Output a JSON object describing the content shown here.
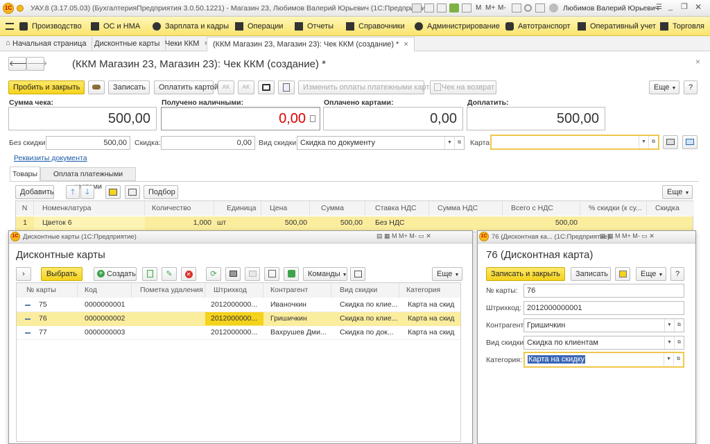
{
  "window": {
    "title": "УАУ.8 (3.17.05.03) (БухгалтерияПредприятия 3.0.50.1221) - Магазин 23, Любимов Валерий Юрьевич (1С:Предприятие)",
    "user": "Любимов Валерий Юрьевич"
  },
  "menu": [
    "Производство",
    "ОС и НМА",
    "Зарплата и кадры",
    "Операции",
    "Отчеты",
    "Справочники",
    "Администрирование",
    "Автотранспорт",
    "Оперативный учет",
    "Торговля"
  ],
  "tabs": [
    "Начальная страница",
    "Дисконтные карты",
    "Чеки ККМ",
    "(ККМ Магазин 23, Магазин 23): Чек ККМ (создание) *"
  ],
  "doc": {
    "title": "(ККМ Магазин 23, Магазин 23): Чек ККМ (создание) *",
    "btn_post_close": "Пробить и закрыть",
    "btn_save": "Записать",
    "btn_pay_card": "Оплатить картой",
    "btn_change_payments": "Изменить оплаты платежными картами",
    "btn_return": "Чек на возврат",
    "btn_more": "Еще",
    "btn_help": "?",
    "sum_label": "Сумма чека:",
    "sum_value": "500,00",
    "cash_label": "Получено наличными:",
    "cash_value": "0,00",
    "card_paid_label": "Оплачено картами:",
    "card_paid_value": "0,00",
    "topay_label": "Доплатить:",
    "topay_value": "500,00",
    "nodisc_label": "Без скидки:",
    "nodisc_value": "500,00",
    "disc_label": "Скидка:",
    "disc_value": "0,00",
    "disctype_label": "Вид скидки:",
    "disctype_value": "Скидка по документу",
    "card_label": "Карта:",
    "card_value": "",
    "requisites_link": "Реквизиты документа",
    "subtab_goods": "Товары",
    "subtab_payments": "Оплата платежными картами",
    "btn_add": "Добавить",
    "btn_select": "Подбор",
    "btn_more2": "Еще",
    "columns": [
      "N",
      "Номенклатура",
      "Количество",
      "Единица",
      "Цена",
      "Сумма",
      "Ставка НДС",
      "Сумма НДС",
      "Всего с НДС",
      "% скидки (к су...",
      "Скидка"
    ],
    "rows": [
      [
        "1",
        "Цветок 6",
        "1,000",
        "шт",
        "500,00",
        "500,00",
        "Без НДС",
        "",
        "500,00",
        "",
        ""
      ]
    ]
  },
  "cards_window": {
    "caption": "Дисконтные карты (1С:Предприятие)",
    "title": "Дисконтные карты",
    "btn_choose": "Выбрать",
    "btn_create": "Создать",
    "btn_commands": "Команды",
    "btn_more": "Еще",
    "columns": [
      "№ карты",
      "Код",
      "Пометка удаления",
      "Штрихкод",
      "Контрагент",
      "Вид скидки",
      "Категория"
    ],
    "rows": [
      [
        "75",
        "0000000001",
        "",
        "2012000000...",
        "Иваночкин",
        "Скидка по клие...",
        "Карта на скид"
      ],
      [
        "76",
        "0000000002",
        "",
        "2012000000...",
        "Гришичкин",
        "Скидка по клие...",
        "Карта на скид"
      ],
      [
        "77",
        "0000000003",
        "",
        "2012000000...",
        "Вахрушев Дми...",
        "Скидка по док...",
        "Карта на скид"
      ]
    ]
  },
  "card_window": {
    "caption": "76 (Дисконтная ка... (1С:Предприятие)",
    "title": "76 (Дисконтная карта)",
    "btn_save_close": "Записать и закрыть",
    "btn_save": "Записать",
    "btn_more": "Еще",
    "btn_help": "?",
    "number_label": "№ карты:",
    "number_value": "76",
    "barcode_label": "Штрихкод:",
    "barcode_value": "2012000000001",
    "contractor_label": "Контрагент:",
    "contractor_value": "Гришичкин",
    "disctype_label": "Вид скидки:",
    "disctype_value": "Скидка по клиентам",
    "category_label": "Категория:",
    "category_value": "Карта на скидку"
  }
}
